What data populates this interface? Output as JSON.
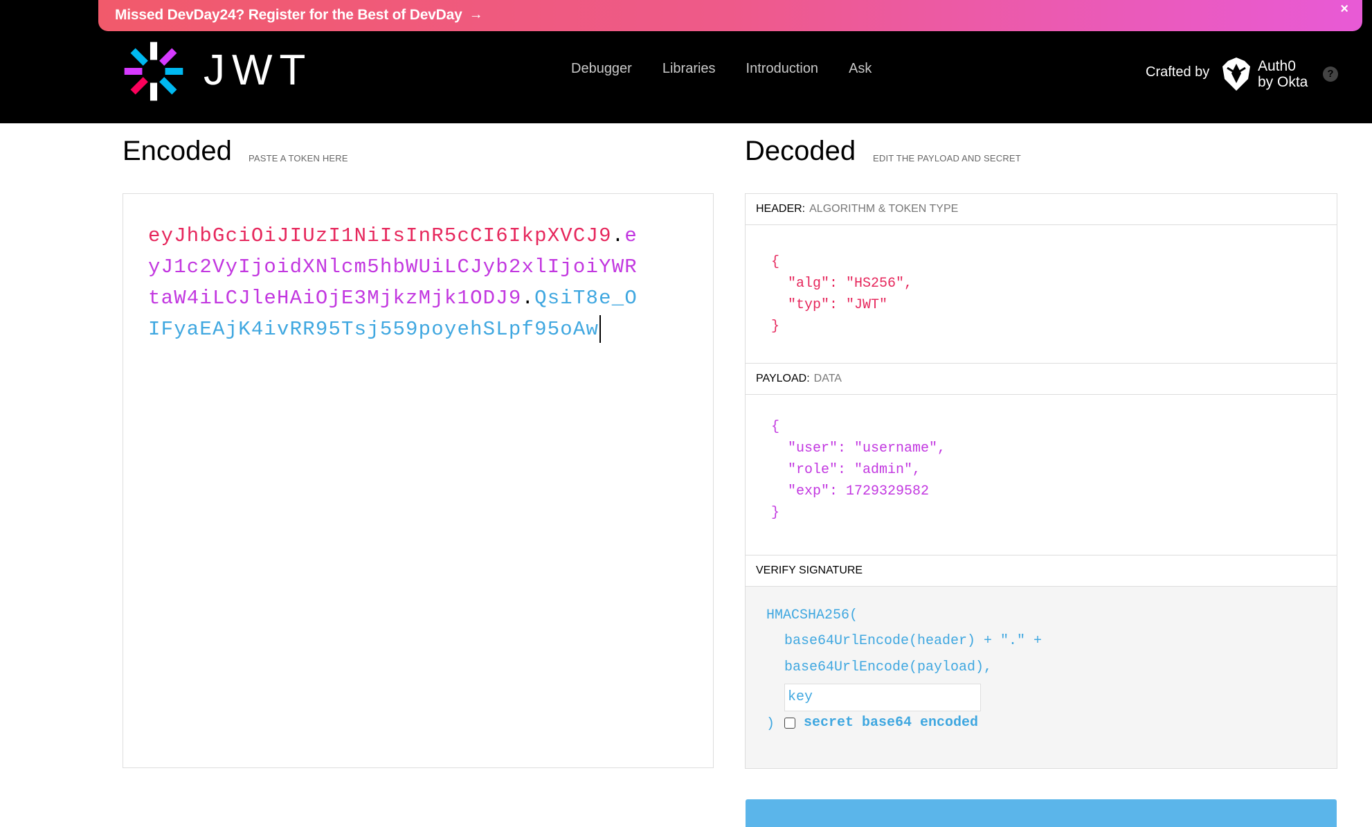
{
  "banner": {
    "text": "Missed DevDay24? Register for the Best of DevDay",
    "arrow": "→",
    "close": "×"
  },
  "logo": {
    "text": "JWT"
  },
  "nav": [
    "Debugger",
    "Libraries",
    "Introduction",
    "Ask"
  ],
  "crafted": {
    "label": "Crafted by",
    "brand_line1": "Auth0",
    "brand_line2": "by Okta",
    "help": "?"
  },
  "encoded": {
    "title": "Encoded",
    "subtitle": "PASTE A TOKEN HERE",
    "token_header": "eyJhbGciOiJIUzI1NiIsInR5cCI6IkpXVCJ9",
    "token_payload": "eyJ1c2VyIjoidXNlcm5hbWUiLCJyb2xlIjoiYWRtaW4iLCJleHAiOjE3MjkzMjk1ODJ9",
    "token_signature": "QsiT8e_OIFyaEAjK4ivRR95Tsj559poyehSLpf95oAw",
    "dot": "."
  },
  "decoded": {
    "title": "Decoded",
    "subtitle": "EDIT THE PAYLOAD AND SECRET",
    "header_section": {
      "key": "HEADER:",
      "value": "ALGORITHM & TOKEN TYPE"
    },
    "header_json": "{\n  \"alg\": \"HS256\",\n  \"typ\": \"JWT\"\n}",
    "payload_section": {
      "key": "PAYLOAD:",
      "value": "DATA"
    },
    "payload_json": "{\n  \"user\": \"username\",\n  \"role\": \"admin\",\n  \"exp\": 1729329582\n}",
    "verify_section": {
      "key": "VERIFY SIGNATURE"
    },
    "verify": {
      "fn_open": "HMACSHA256(",
      "line1": "base64UrlEncode(header) + \".\" +",
      "line2": "base64UrlEncode(payload),",
      "key_value": "key",
      "fn_close": ")",
      "checkbox_label": "secret base64 encoded"
    }
  },
  "colors": {
    "header": "#e6275c",
    "payload": "#c237e0",
    "signature": "#3fa7e0"
  }
}
